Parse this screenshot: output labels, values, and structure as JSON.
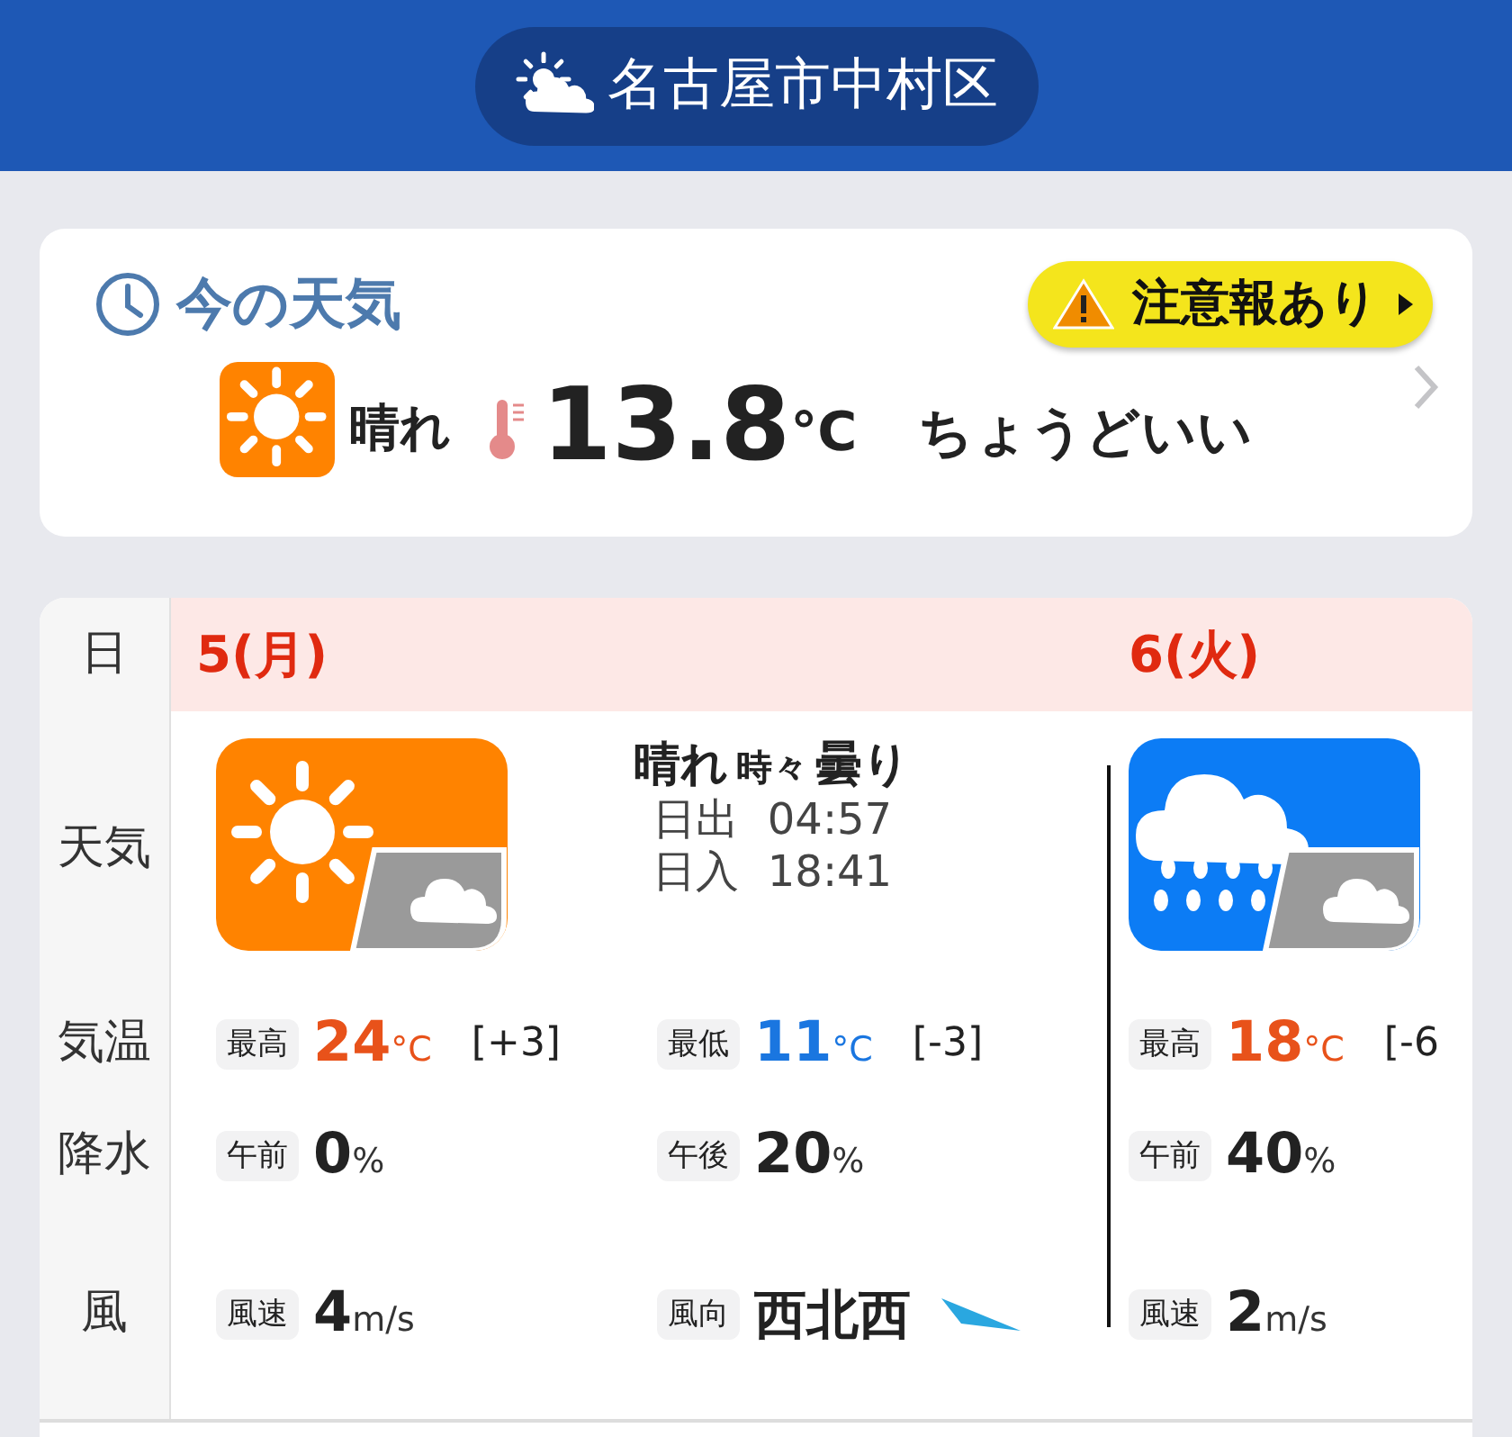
{
  "header": {
    "location": "名古屋市中村区"
  },
  "current": {
    "title": "今の天気",
    "alert": "注意報あり",
    "weather": "晴れ",
    "kind": "sunny",
    "temperature": "13.8",
    "unit": "°C",
    "feeling": "ちょうどいい"
  },
  "forecast": {
    "row_labels": [
      "日",
      "天気",
      "気温",
      "降水",
      "風"
    ],
    "days": [
      {
        "date": "5(月)",
        "kind": "sunny-then-cloudy",
        "weather": "晴れ",
        "connector": "時々",
        "weather_later": "曇り",
        "sunrise_label": "日出",
        "sunrise": "04:57",
        "sunset_label": "日入",
        "sunset": "18:41",
        "temperature": [
          {
            "label": "最高",
            "kind": "high",
            "value": "24",
            "unit": "°C",
            "diff": "[+3]"
          },
          {
            "label": "最低",
            "kind": "low",
            "value": "11",
            "unit": "°C",
            "diff": "[-3]"
          }
        ],
        "precipitation": [
          {
            "label": "午前",
            "value": "0",
            "unit": "%"
          },
          {
            "label": "午後",
            "value": "20",
            "unit": "%"
          }
        ],
        "wind": [
          {
            "kind": "speed",
            "label": "風速",
            "value": "4",
            "unit": "m/s"
          },
          {
            "kind": "direction",
            "label": "風向",
            "value": "西北西"
          }
        ]
      },
      {
        "date": "6(火)",
        "kind": "rainy-then-cloudy",
        "temperature": [
          {
            "label": "最高",
            "kind": "high",
            "value": "18",
            "unit": "°C",
            "diff": "[-6"
          }
        ],
        "precipitation": [
          {
            "label": "午前",
            "value": "40",
            "unit": "%"
          }
        ],
        "wind": [
          {
            "kind": "speed",
            "label": "風速",
            "value": "2",
            "unit": "m/s"
          }
        ]
      }
    ]
  }
}
